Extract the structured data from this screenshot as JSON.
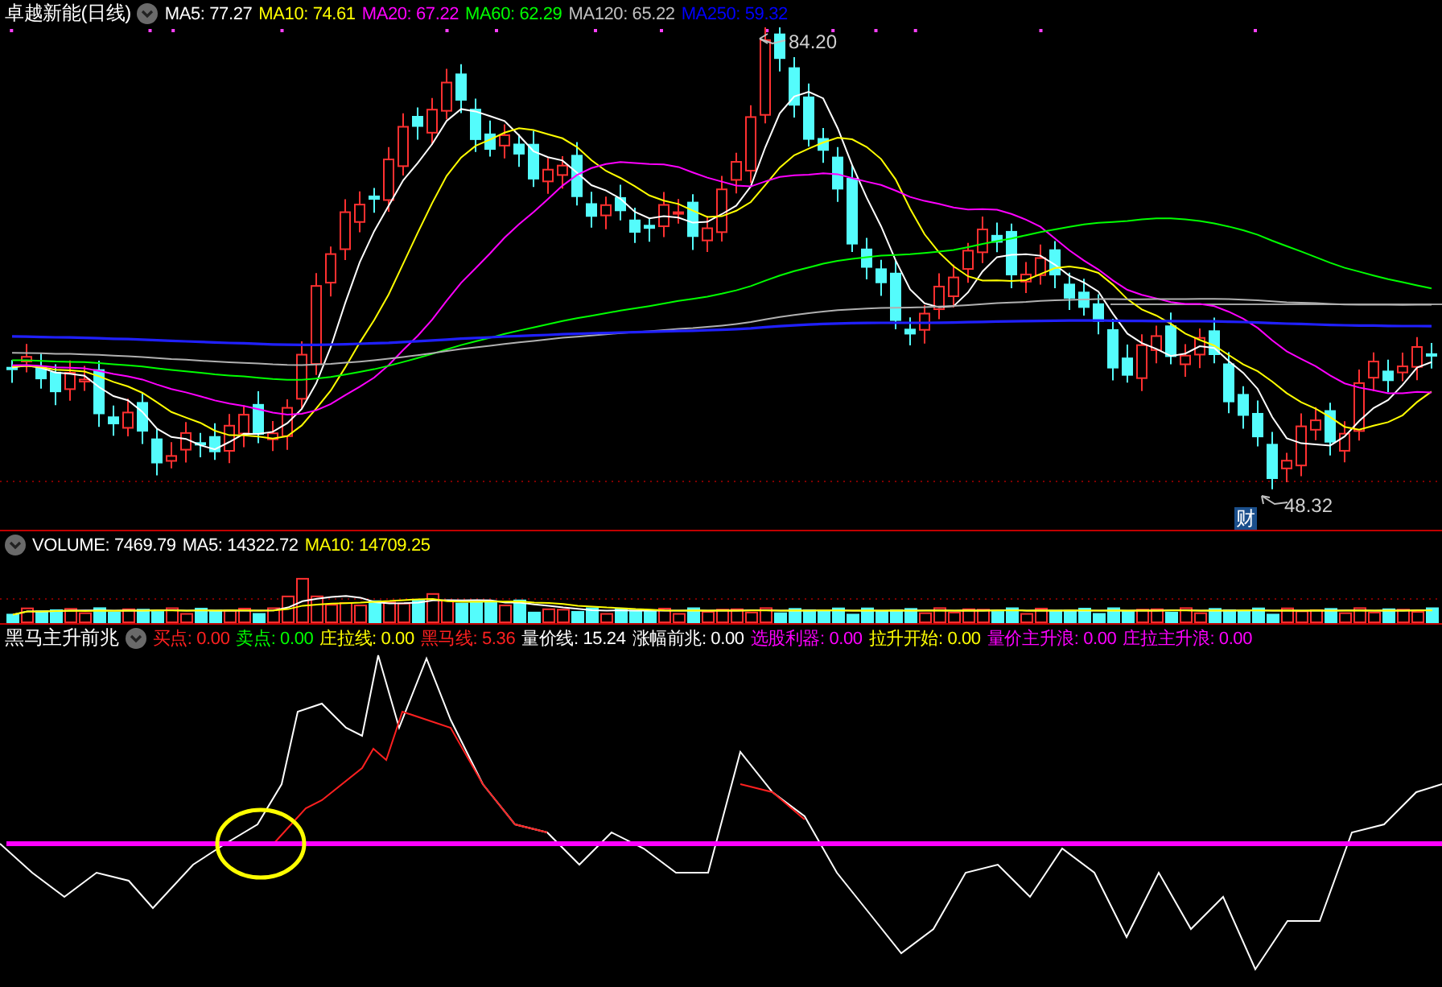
{
  "title": "卓越新能(日线)",
  "ma_legend": [
    {
      "label": "MA5:",
      "value": "77.27",
      "color": "#ffffff"
    },
    {
      "label": "MA10:",
      "value": "74.61",
      "color": "#ffff00"
    },
    {
      "label": "MA20:",
      "value": "67.22",
      "color": "#ff00ff"
    },
    {
      "label": "MA60:",
      "value": "62.29",
      "color": "#00ff00"
    },
    {
      "label": "MA120:",
      "value": "65.22",
      "color": "#c0c0c0"
    },
    {
      "label": "MA250:",
      "value": "59.32",
      "color": "#0000ff"
    }
  ],
  "price_high": "84.20",
  "price_low": "48.32",
  "finance_badge": "财",
  "volume_legend": [
    {
      "label": "VOLUME:",
      "value": "7469.79",
      "color": "#ffffff"
    },
    {
      "label": "MA5:",
      "value": "14322.72",
      "color": "#ffffff"
    },
    {
      "label": "MA10:",
      "value": "14709.25",
      "color": "#ffff00"
    }
  ],
  "indicator": {
    "name": "黑马主升前兆",
    "legend": [
      {
        "label": "买点:",
        "value": "0.00",
        "color": "#ff2020"
      },
      {
        "label": "卖点:",
        "value": "0.00",
        "color": "#00ff00"
      },
      {
        "label": "庄拉线:",
        "value": "0.00",
        "color": "#ffff00"
      },
      {
        "label": "黑马线:",
        "value": "5.36",
        "color": "#ff2020"
      },
      {
        "label": "量价线:",
        "value": "15.24",
        "color": "#ffffff"
      },
      {
        "label": "涨幅前兆:",
        "value": "0.00",
        "color": "#ffffff"
      },
      {
        "label": "选股利器:",
        "value": "0.00",
        "color": "#ff00ff"
      },
      {
        "label": "拉升开始:",
        "value": "0.00",
        "color": "#ffff00"
      },
      {
        "label": "量价主升浪:",
        "value": "0.00",
        "color": "#ff00ff"
      },
      {
        "label": "庄拉主升浪:",
        "value": "0.00",
        "color": "#ff00ff"
      }
    ]
  }
}
